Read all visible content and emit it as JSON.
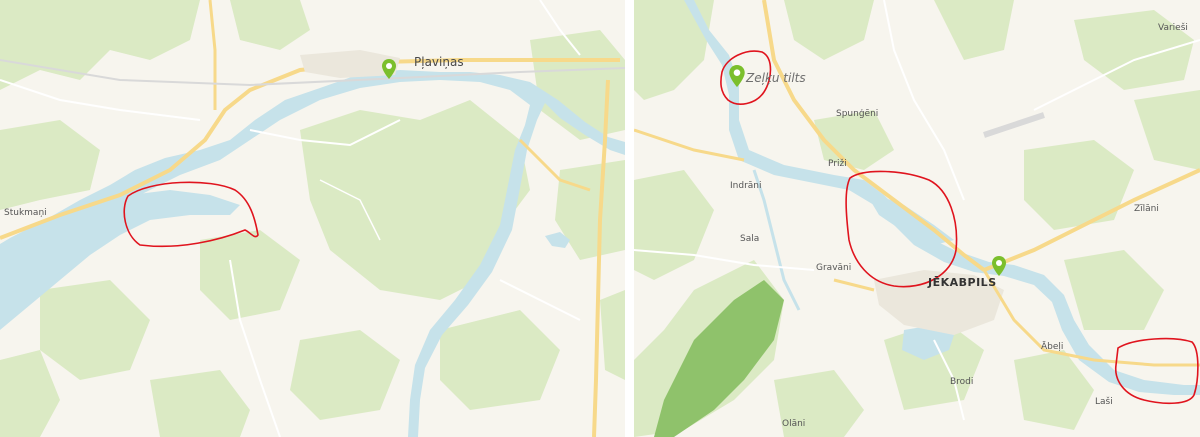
{
  "maps": {
    "left": {
      "labels": {
        "plavinas": "Pļaviņas",
        "stukmani": "Stukmaņi"
      },
      "marker_icon": "location-pin",
      "highlight_color": "#e0141e"
    },
    "right": {
      "labels": {
        "zelku_tilts": "Zeļķu tilts",
        "spungeni": "Spunģēni",
        "prizi": "Priži",
        "indrani": "Indrāni",
        "sala": "Sala",
        "gravani": "Gravāni",
        "jekabpils": "JĒKABPILS",
        "zilani": "Zīlāni",
        "varies": "Varieši",
        "abeli": "Ābeļi",
        "brodi": "Brodi",
        "lasi": "Laši",
        "olani": "Olāni"
      },
      "marker_icon": "location-pin",
      "highlight_color": "#e0141e"
    }
  },
  "colors": {
    "land": "#f7f5ee",
    "forest": "#dbeac4",
    "water": "#c6e2ea",
    "road_major": "#f7d98a",
    "road_minor": "#ffffff",
    "pin": "#7bbf2c",
    "annotation": "#e0141e"
  }
}
